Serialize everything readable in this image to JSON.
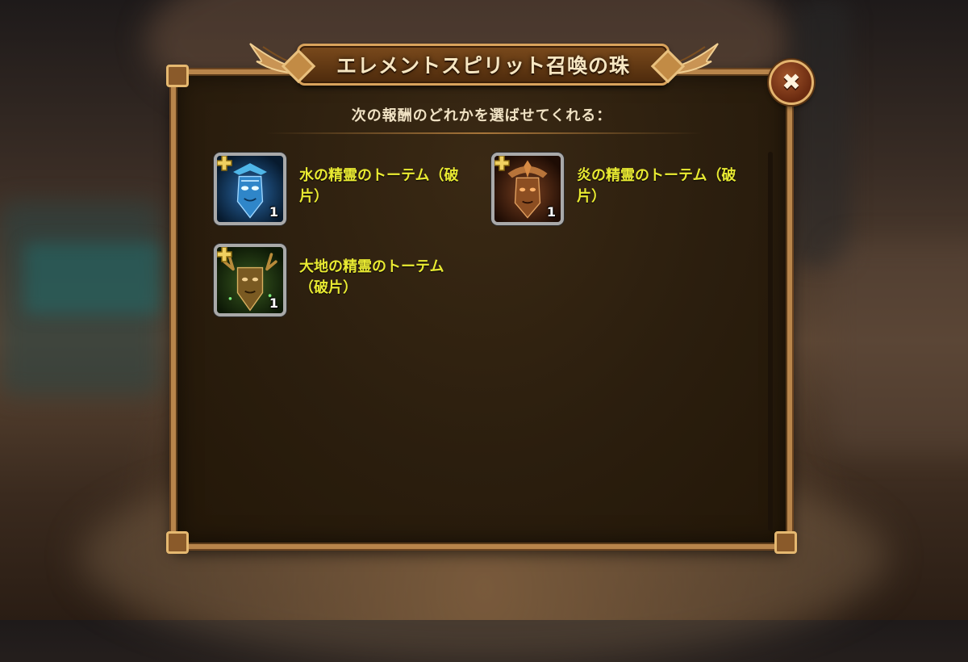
{
  "dialog": {
    "title": "エレメントスピリット召喚の珠",
    "subtitle": "次の報酬のどれかを選ばせてくれる：",
    "close_icon": "close-icon"
  },
  "rewards": [
    {
      "name": "水の精霊のトーテム（破片）",
      "quantity": "1",
      "icon": "water-totem-icon"
    },
    {
      "name": "炎の精霊のトーテム（破片）",
      "quantity": "1",
      "icon": "fire-totem-icon"
    },
    {
      "name": "大地の精霊のトーテム（破片）",
      "quantity": "1",
      "icon": "earth-totem-icon"
    }
  ],
  "colors": {
    "panel_border": "#b8854b",
    "label_yellow": "#e9ea32",
    "title_text": "#f6e6c2"
  }
}
